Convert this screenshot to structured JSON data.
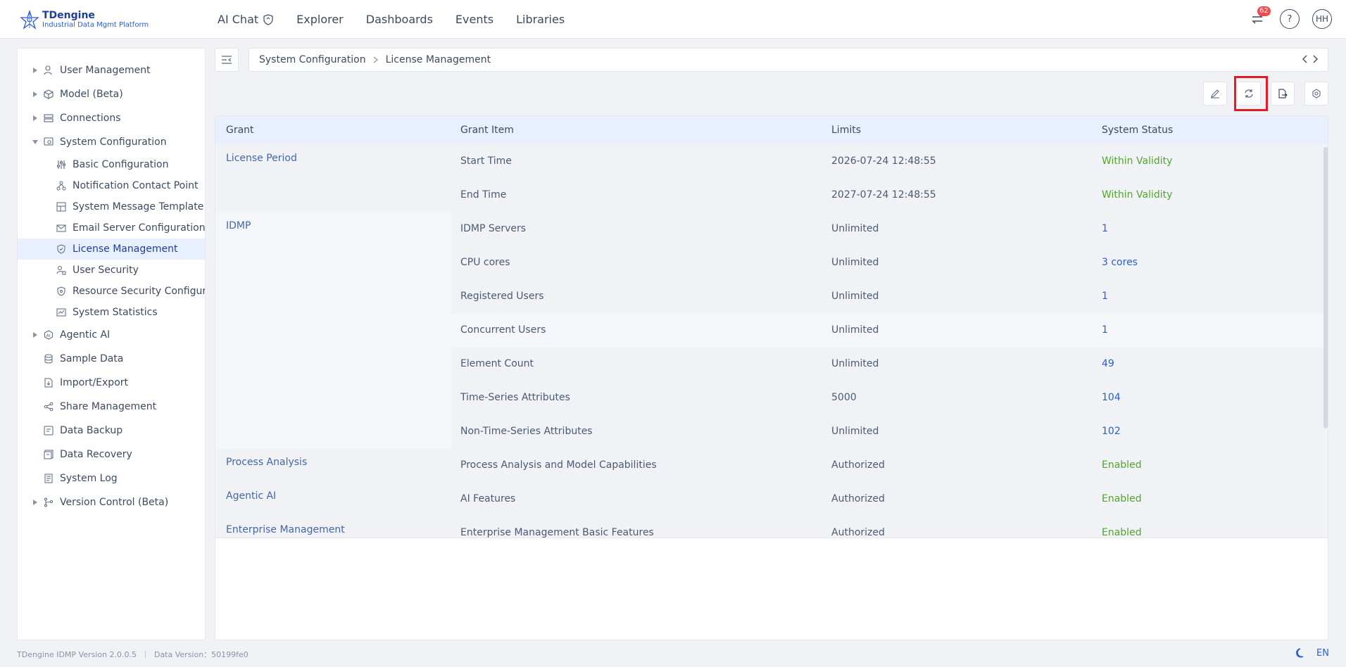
{
  "app": {
    "brand_title": "TDengine",
    "brand_subtitle": "Industrial Data Mgmt Platform"
  },
  "nav": {
    "items": [
      "AI Chat",
      "Explorer",
      "Dashboards",
      "Events",
      "Libraries"
    ]
  },
  "header": {
    "notification_count": "62",
    "help_label": "?",
    "avatar_initials": "HH"
  },
  "sidebar": {
    "user_management": "User Management",
    "model": "Model (Beta)",
    "connections": "Connections",
    "system_configuration": "System Configuration",
    "basic_configuration": "Basic Configuration",
    "notification_contact_point": "Notification Contact Point",
    "system_message_template": "System Message Template",
    "email_server_configuration": "Email Server Configuration",
    "license_management": "License Management",
    "user_security": "User Security",
    "resource_security": "Resource Security Configurati",
    "system_statistics": "System Statistics",
    "agentic_ai": "Agentic AI",
    "sample_data": "Sample Data",
    "import_export": "Import/Export",
    "share_management": "Share Management",
    "data_backup": "Data Backup",
    "data_recovery": "Data Recovery",
    "system_log": "System Log",
    "version_control": "Version Control (Beta)"
  },
  "breadcrumb": {
    "parent": "System Configuration",
    "current": "License Management"
  },
  "table": {
    "headers": {
      "grant": "Grant",
      "grant_item": "Grant Item",
      "limits": "Limits",
      "status": "System Status"
    },
    "groups": {
      "license_period": "License Period",
      "idmp": "IDMP",
      "process_analysis": "Process Analysis",
      "agentic_ai": "Agentic AI",
      "enterprise_management": "Enterprise Management"
    },
    "rows": [
      {
        "item": "Start Time",
        "limit": "2026-07-24 12:48:55",
        "status": "Within Validity"
      },
      {
        "item": "End Time",
        "limit": "2027-07-24 12:48:55",
        "status": "Within Validity"
      },
      {
        "item": "IDMP Servers",
        "limit": "Unlimited",
        "status": "1"
      },
      {
        "item": "CPU cores",
        "limit": "Unlimited",
        "status": "3 cores"
      },
      {
        "item": "Registered Users",
        "limit": "Unlimited",
        "status": "1"
      },
      {
        "item": "Concurrent Users",
        "limit": "Unlimited",
        "status": "1"
      },
      {
        "item": "Element Count",
        "limit": "Unlimited",
        "status": "49"
      },
      {
        "item": "Time-Series Attributes",
        "limit": "5000",
        "status": "104"
      },
      {
        "item": "Non-Time-Series Attributes",
        "limit": "Unlimited",
        "status": "102"
      },
      {
        "item": "Process Analysis and Model Capabilities",
        "limit": "Authorized",
        "status": "Enabled"
      },
      {
        "item": "AI Features",
        "limit": "Authorized",
        "status": "Enabled"
      },
      {
        "item": "Enterprise Management Basic Features",
        "limit": "Authorized",
        "status": "Enabled"
      }
    ]
  },
  "footer": {
    "version": "TDengine IDMP Version 2.0.0.5",
    "data_version": "Data Version：50199fe0",
    "language": "EN"
  },
  "colors": {
    "accent": "#2a5fd6",
    "success": "#52a62c",
    "highlight": "#e21b24"
  }
}
